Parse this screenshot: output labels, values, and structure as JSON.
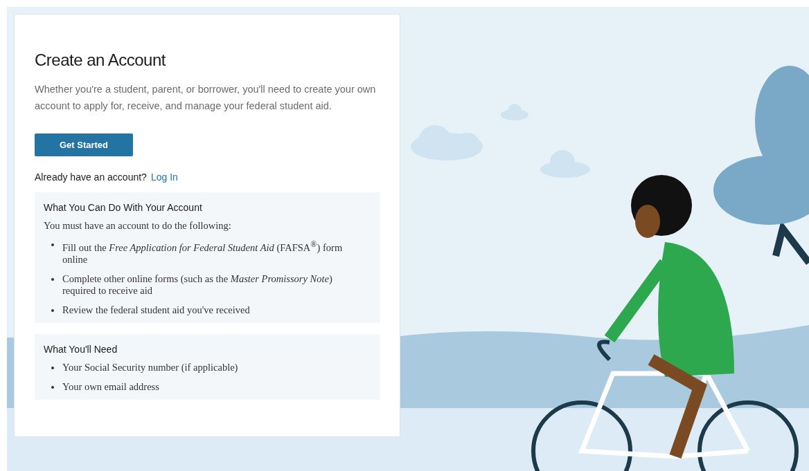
{
  "card": {
    "title": "Create an Account",
    "intro": "Whether you're a student, parent, or borrower, you'll need to create your own account to apply for, receive, and manage your federal student aid.",
    "primary_button": "Get Started",
    "login_prompt": "Already have an account?",
    "login_link": "Log In"
  },
  "sections": [
    {
      "heading": "What You Can Do With Your Account",
      "lead": "You must have an account to do the following:",
      "items": [
        "Fill out the *Free Application for Federal Student Aid* (FAFSA$^{®}$) form online",
        "Complete other online forms (such as the *Master Promissory Note*) required to receive aid",
        "Review the federal student aid you've received"
      ]
    },
    {
      "heading": "What You'll Need",
      "items": [
        "Your Social Security number (if applicable)",
        "Your own email address"
      ]
    }
  ]
}
